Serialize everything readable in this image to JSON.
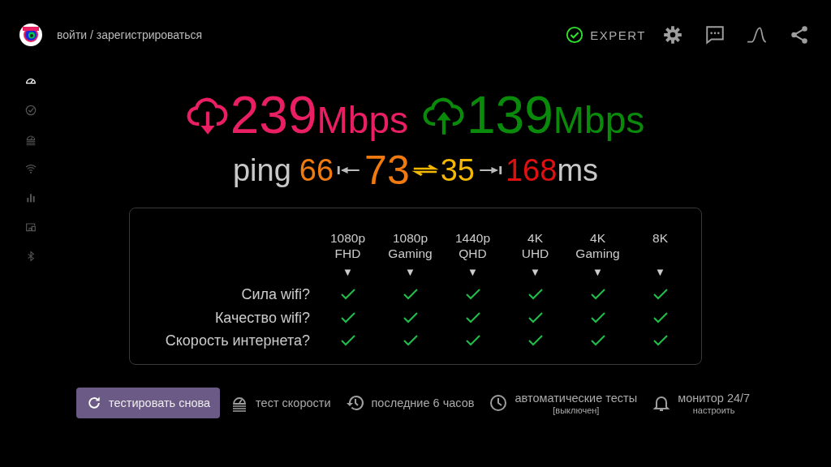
{
  "header": {
    "login": "войти / зарегистрироваться",
    "badge": {
      "label": "EXPERT",
      "checked": true
    },
    "tools": [
      {
        "kind": "settings"
      },
      {
        "kind": "chat"
      },
      {
        "kind": "curve"
      },
      {
        "kind": "share"
      }
    ]
  },
  "sidebar": {
    "items": [
      {
        "kind": "gauge",
        "selected": true
      },
      {
        "kind": "check",
        "selected": false
      },
      {
        "kind": "meter",
        "selected": false
      },
      {
        "kind": "wifi",
        "selected": false
      },
      {
        "kind": "bars",
        "selected": false
      },
      {
        "kind": "devices",
        "selected": false
      },
      {
        "kind": "bluetooth",
        "selected": false
      }
    ]
  },
  "speeds": [
    {
      "kind": "download",
      "value": "239",
      "unit": "Mbps",
      "color": "#e91e63"
    },
    {
      "kind": "upload",
      "value": "139",
      "unit": "Mbps",
      "color": "#0a8a0a"
    }
  ],
  "ping": {
    "label": "ping",
    "min": "66",
    "avg": "73",
    "jitter": "35",
    "max": "168",
    "unit": "ms"
  },
  "quality": {
    "columns": [
      {
        "line1": "1080p",
        "line2": "FHD",
        "marker": "▼"
      },
      {
        "line1": "1080p",
        "line2": "Gaming",
        "marker": "▼"
      },
      {
        "line1": "1440p",
        "line2": "QHD",
        "marker": "▼"
      },
      {
        "line1": "4K",
        "line2": "UHD",
        "marker": "▼"
      },
      {
        "line1": "4K",
        "line2": "Gaming",
        "marker": "▼"
      },
      {
        "line1": "8K",
        "marker": "▼"
      }
    ],
    "rows": [
      {
        "label": "Сила wifi?",
        "checks": [
          true,
          true,
          true,
          true,
          true,
          true
        ]
      },
      {
        "label": "Качество wifi?",
        "checks": [
          true,
          true,
          true,
          true,
          true,
          true
        ]
      },
      {
        "label": "Скорость интернета?",
        "checks": [
          true,
          true,
          true,
          true,
          true,
          true
        ]
      }
    ]
  },
  "actions": [
    {
      "kind": "retest",
      "label": "тестировать снова"
    },
    {
      "kind": "speed",
      "label": "тест скорости"
    },
    {
      "kind": "history",
      "label": "последние 6 часов"
    },
    {
      "kind": "auto",
      "label": "автоматические тесты",
      "sub": "[выключен]"
    },
    {
      "kind": "monitor",
      "label": "монитор 24/7",
      "sub": "настроить"
    }
  ]
}
